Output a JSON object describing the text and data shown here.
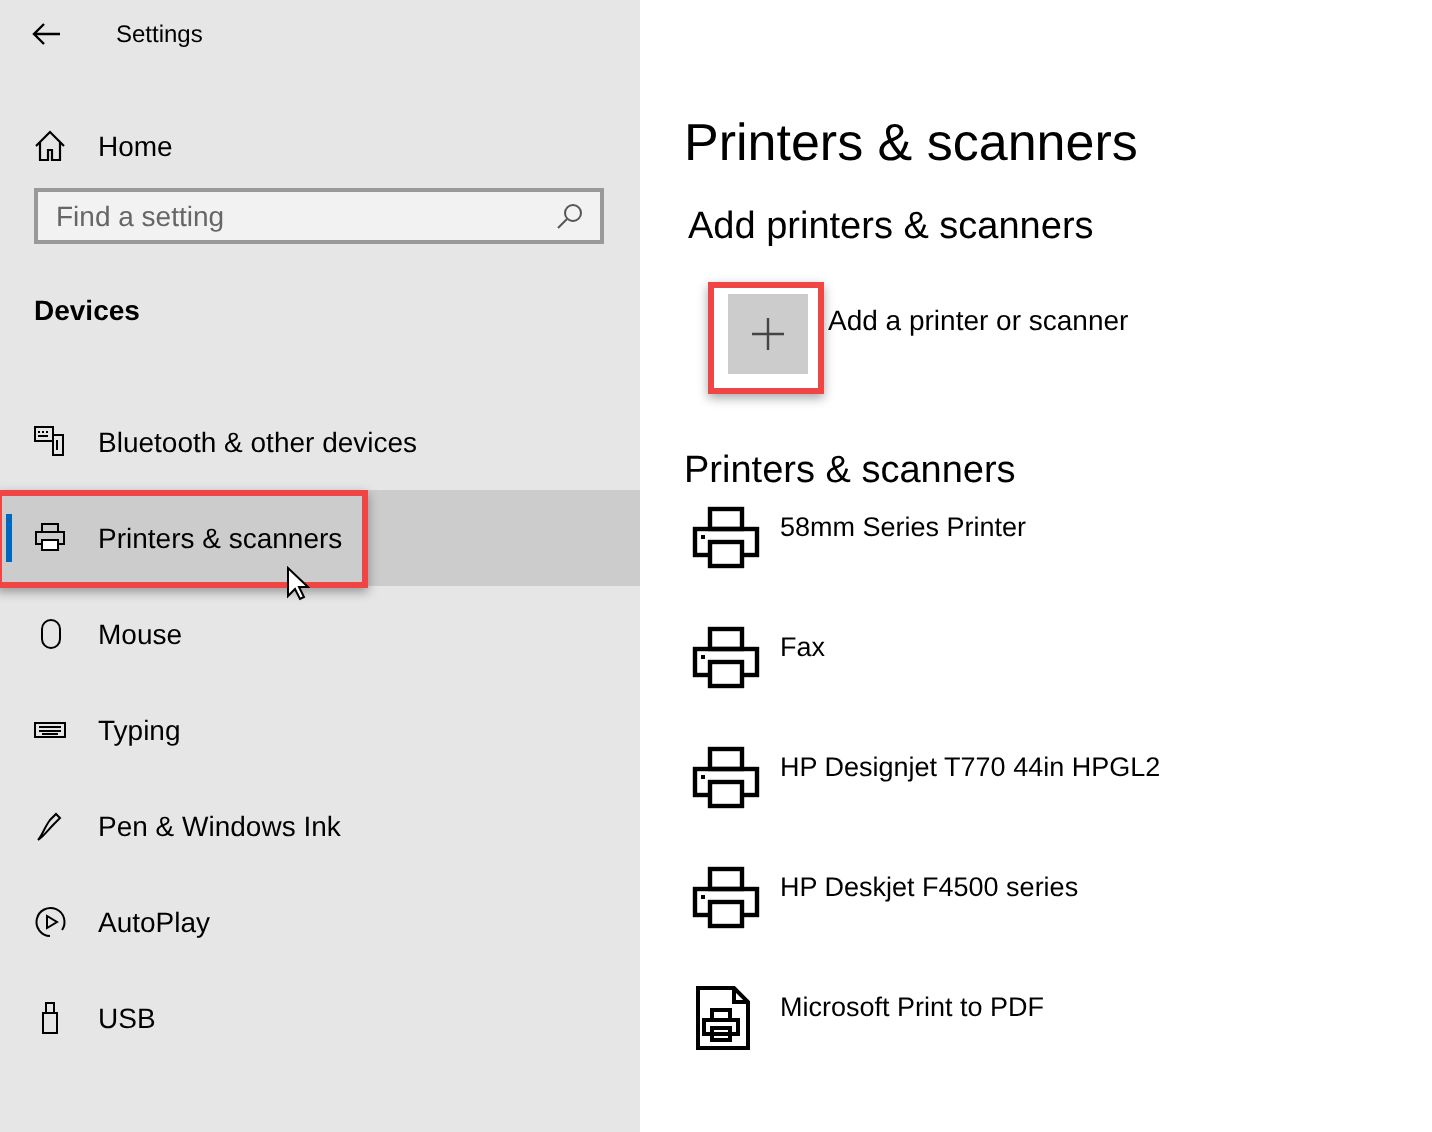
{
  "window": {
    "title": "Settings"
  },
  "sidebar": {
    "home": "Home",
    "search": {
      "placeholder": "Find a setting"
    },
    "section": "Devices",
    "items": [
      {
        "label": "Bluetooth & other devices",
        "kind": "bluetooth",
        "selected": false,
        "highlighted": false
      },
      {
        "label": "Printers & scanners",
        "kind": "printer",
        "selected": true,
        "highlighted": true
      },
      {
        "label": "Mouse",
        "kind": "mouse",
        "selected": false,
        "highlighted": false
      },
      {
        "label": "Typing",
        "kind": "keyboard",
        "selected": false,
        "highlighted": false
      },
      {
        "label": "Pen & Windows Ink",
        "kind": "pen",
        "selected": false,
        "highlighted": false
      },
      {
        "label": "AutoPlay",
        "kind": "autoplay",
        "selected": false,
        "highlighted": false
      },
      {
        "label": "USB",
        "kind": "usb",
        "selected": false,
        "highlighted": false
      }
    ]
  },
  "main": {
    "title": "Printers & scanners",
    "add_heading": "Add printers & scanners",
    "add_button": {
      "label": "Add a printer or scanner",
      "highlighted": true
    },
    "list_heading": "Printers & scanners",
    "printers": [
      {
        "name": "58mm Series Printer",
        "kind": "printer"
      },
      {
        "name": "Fax",
        "kind": "printer"
      },
      {
        "name": "HP Designjet T770 44in HPGL2",
        "kind": "printer"
      },
      {
        "name": "HP Deskjet F4500 series",
        "kind": "printer"
      },
      {
        "name": "Microsoft Print to PDF",
        "kind": "document"
      }
    ]
  }
}
